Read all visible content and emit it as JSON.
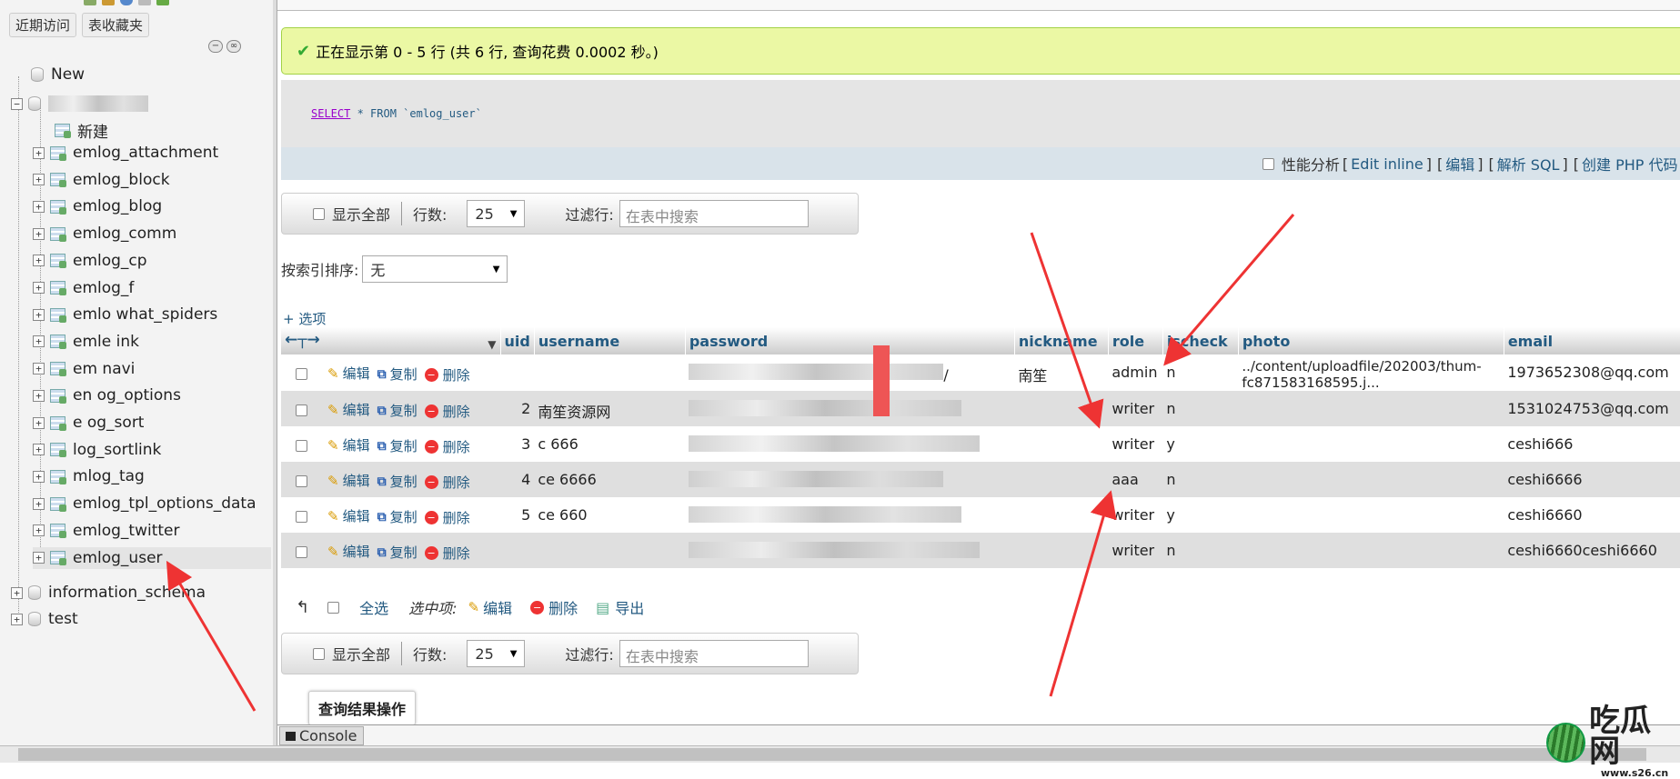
{
  "sidebar": {
    "recent_label": "近期访问",
    "favorites_label": "表收藏夹",
    "new_label": "New",
    "db_new_label": "新建",
    "tables": [
      "emlog_attachment",
      "emlog_block",
      "emlog_blog",
      "emlog_comm",
      "emlog_cp",
      "emlog_f",
      "emlo what_spiders",
      "emle ink",
      "em navi",
      "en og_options",
      "e og_sort",
      "log_sortlink",
      "mlog_tag",
      "emlog_tpl_options_data",
      "emlog_twitter",
      "emlog_user"
    ],
    "databases": [
      "information_schema",
      "test"
    ]
  },
  "main": {
    "success_message": "正在显示第 0 - 5 行 (共 6 行, 查询花费 0.0002 秒。)",
    "sql": {
      "kw1": "SELECT",
      "rest": " * FROM ",
      "table": "`emlog_user`"
    },
    "toolbar": {
      "profiling_label": "性能分析",
      "edit_inline": "Edit inline",
      "edit": "编辑",
      "explain_sql": "解析 SQL",
      "create_php": "创建 PHP 代码",
      "bracket_open": "[",
      "bracket_close": "]"
    },
    "nav": {
      "show_all": "显示全部",
      "rows_label": "行数:",
      "rows_value": "25",
      "filter_label": "过滤行:",
      "filter_placeholder": "在表中搜索"
    },
    "sort_label": "按索引排序:",
    "sort_value": "无",
    "options_link": "+ 选项",
    "actions": {
      "edit": "编辑",
      "copy": "复制",
      "delete": "删除"
    },
    "columns": [
      "uid",
      "username",
      "password",
      "nickname",
      "role",
      "ischeck",
      "photo",
      "email"
    ],
    "rows": [
      {
        "uid": "",
        "username": "",
        "nickname": "南笙",
        "role": "admin",
        "ischeck": "n",
        "photo1": "../content/uploadfile/202003/thum-",
        "photo2": "fc871583168595.j...",
        "email": "1973652308@qq.com",
        "extra": "/"
      },
      {
        "uid": "2",
        "username": "南笙资源网",
        "nickname": "",
        "role": "writer",
        "ischeck": "n",
        "photo1": "",
        "photo2": "",
        "email": "1531024753@qq.com",
        "extra": ""
      },
      {
        "uid": "3",
        "username": "c 666",
        "nickname": "",
        "role": "writer",
        "ischeck": "y",
        "photo1": "",
        "photo2": "",
        "email": "ceshi666",
        "extra": ""
      },
      {
        "uid": "4",
        "username": "ce 6666",
        "nickname": "",
        "role": "aaa",
        "ischeck": "n",
        "photo1": "",
        "photo2": "",
        "email": "ceshi6666",
        "extra": ""
      },
      {
        "uid": "5",
        "username": "ce 660",
        "nickname": "",
        "role": "writer",
        "ischeck": "y",
        "photo1": "",
        "photo2": "",
        "email": "ceshi6660",
        "extra": ""
      },
      {
        "uid": "",
        "username": "",
        "nickname": "",
        "role": "writer",
        "ischeck": "n",
        "photo1": "",
        "photo2": "",
        "email": "ceshi6660ceshi6660",
        "extra": ""
      }
    ],
    "bulk": {
      "select_all": "全选",
      "with_selected": "选中项:",
      "edit": "编辑",
      "delete": "删除",
      "export": "导出"
    },
    "query_ops": "查询结果操作",
    "console": "Console"
  },
  "watermark": {
    "text": "吃瓜网",
    "url": "www.s26.cn"
  },
  "colors": {
    "link": "#235a81",
    "success_bg": "#ebf8a4",
    "arrow": "#ee3333"
  }
}
